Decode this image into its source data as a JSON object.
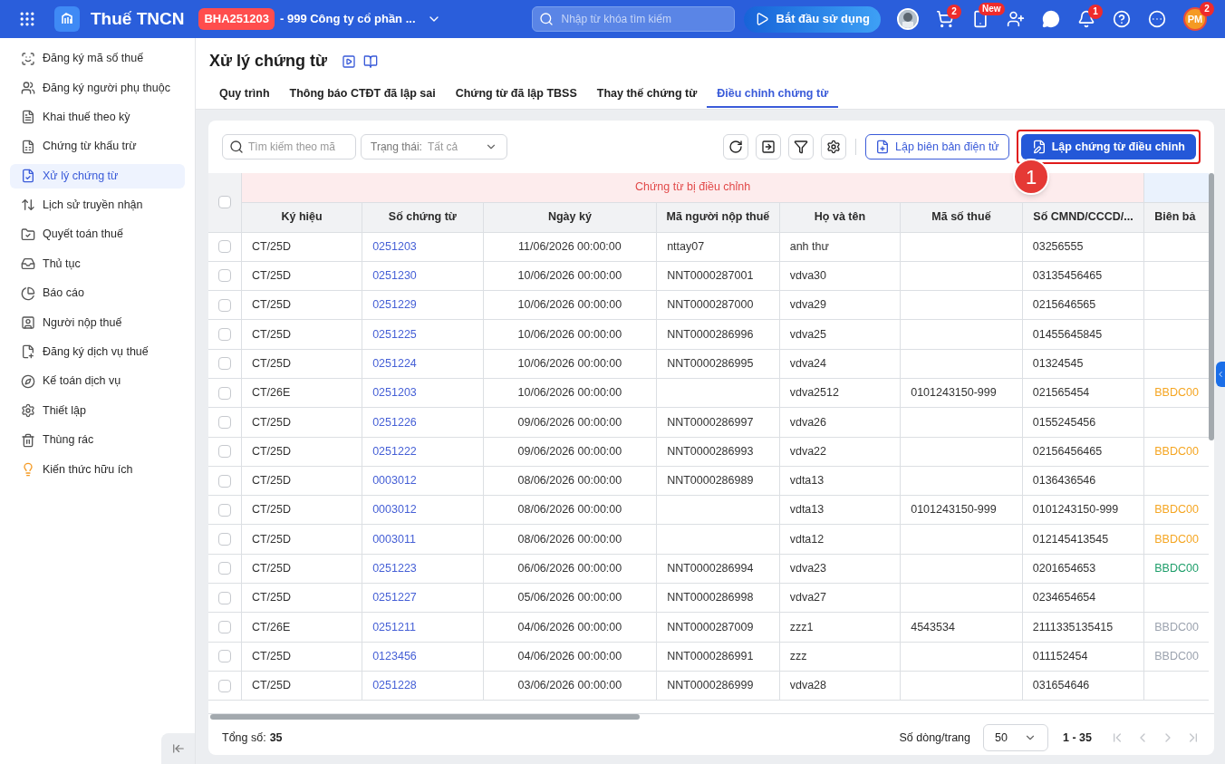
{
  "topbar": {
    "app_name": "Thuế TNCN",
    "tenant_code": "BHA251203",
    "tenant_name": "- 999 Công ty cổ phần ...",
    "search": {
      "placeholder": "Nhập từ khóa tìm kiếm"
    },
    "start_button": "Bắt đầu sử dụng",
    "cart_badge": "2",
    "phone_badge": "New",
    "bell_badge": "1",
    "user_initials": "PM",
    "user_badge": "2"
  },
  "sidebar": {
    "items": [
      {
        "label": "Đăng ký mã số thuế",
        "selected": false
      },
      {
        "label": "Đăng ký người phụ thuộc",
        "selected": false
      },
      {
        "label": "Khai thuế theo kỳ",
        "selected": false
      },
      {
        "label": "Chứng từ khấu trừ",
        "selected": false
      },
      {
        "label": "Xử lý chứng từ",
        "selected": true
      },
      {
        "label": "Lịch sử truyền nhận",
        "selected": false
      },
      {
        "label": "Quyết toán thuế",
        "selected": false
      },
      {
        "label": "Thủ tục",
        "selected": false
      },
      {
        "label": "Báo cáo",
        "selected": false
      },
      {
        "label": "Người nộp thuế",
        "selected": false
      },
      {
        "label": "Đăng ký dịch vụ thuế",
        "selected": false
      },
      {
        "label": "Kế toán dịch vụ",
        "selected": false
      },
      {
        "label": "Thiết lập",
        "selected": false
      },
      {
        "label": "Thùng rác",
        "selected": false
      },
      {
        "label": "Kiến thức hữu ích",
        "selected": false
      }
    ]
  },
  "page": {
    "title": "Xử lý chứng từ",
    "tabs": [
      {
        "label": "Quy trình",
        "selected": false
      },
      {
        "label": "Thông báo CTĐT đã lập sai",
        "selected": false
      },
      {
        "label": "Chứng từ đã lập TBSS",
        "selected": false
      },
      {
        "label": "Thay thế chứng từ",
        "selected": false
      },
      {
        "label": "Điều chỉnh chứng từ",
        "selected": true
      }
    ]
  },
  "toolbar": {
    "search": {
      "placeholder": "Tìm kiếm theo mã"
    },
    "status_filter": {
      "label": "Trạng thái:",
      "value": "Tất cả"
    },
    "secondary_button": "Lập biên bản điện tử",
    "primary_button": "Lập chứng từ điều chỉnh",
    "callout": {
      "number": "1",
      "highlighted": true
    }
  },
  "table": {
    "select_all_checked": false,
    "group_header": "Chứng từ bị điều chỉnh",
    "columns": [
      "Ký hiệu",
      "Số chứng từ",
      "Ngày ký",
      "Mã người nộp thuế",
      "Họ và tên",
      "Mã số thuế",
      "Số CMND/CCCD/...",
      "Biên bả"
    ],
    "rows": [
      {
        "checked": false,
        "cells": [
          "CT/25D",
          "0251203",
          "11/06/2026 00:00:00",
          "nttay07",
          "anh thư",
          "",
          "03256555",
          ""
        ]
      },
      {
        "checked": false,
        "cells": [
          "CT/25D",
          "0251230",
          "10/06/2026 00:00:00",
          "NNT0000287001",
          "vdva30",
          "",
          "03135456465",
          ""
        ]
      },
      {
        "checked": false,
        "cells": [
          "CT/25D",
          "0251229",
          "10/06/2026 00:00:00",
          "NNT0000287000",
          "vdva29",
          "",
          "0215646565",
          ""
        ]
      },
      {
        "checked": false,
        "cells": [
          "CT/25D",
          "0251225",
          "10/06/2026 00:00:00",
          "NNT0000286996",
          "vdva25",
          "",
          "01455645845",
          ""
        ]
      },
      {
        "checked": false,
        "cells": [
          "CT/25D",
          "0251224",
          "10/06/2026 00:00:00",
          "NNT0000286995",
          "vdva24",
          "",
          "01324545",
          ""
        ]
      },
      {
        "checked": false,
        "cells": [
          "CT/26E",
          "0251203",
          "10/06/2026 00:00:00",
          "",
          "vdva2512",
          "0101243150-999",
          "021565454",
          "BBDC00"
        ],
        "color": "#f5a623"
      },
      {
        "checked": false,
        "cells": [
          "CT/25D",
          "0251226",
          "09/06/2026 00:00:00",
          "NNT0000286997",
          "vdva26",
          "",
          "0155245456",
          ""
        ]
      },
      {
        "checked": false,
        "cells": [
          "CT/25D",
          "0251222",
          "09/06/2026 00:00:00",
          "NNT0000286993",
          "vdva22",
          "",
          "02156456465",
          "BBDC00"
        ],
        "color": "#f5a623"
      },
      {
        "checked": false,
        "cells": [
          "CT/25D",
          "0003012",
          "08/06/2026 00:00:00",
          "NNT0000286989",
          "vdta13",
          "",
          "0136436546",
          ""
        ]
      },
      {
        "checked": false,
        "cells": [
          "CT/25D",
          "0003012",
          "08/06/2026 00:00:00",
          "",
          "vdta13",
          "0101243150-999",
          "0101243150-999",
          "BBDC00"
        ],
        "color": "#f5a623"
      },
      {
        "checked": false,
        "cells": [
          "CT/25D",
          "0003011",
          "08/06/2026 00:00:00",
          "",
          "vdta12",
          "",
          "012145413545",
          "BBDC00"
        ],
        "color": "#f5a623"
      },
      {
        "checked": false,
        "cells": [
          "CT/25D",
          "0251223",
          "06/06/2026 00:00:00",
          "NNT0000286994",
          "vdva23",
          "",
          "0201654653",
          "BBDC00"
        ],
        "color": "#1e9e6a"
      },
      {
        "checked": false,
        "cells": [
          "CT/25D",
          "0251227",
          "05/06/2026 00:00:00",
          "NNT0000286998",
          "vdva27",
          "",
          "0234654654",
          ""
        ]
      },
      {
        "checked": false,
        "cells": [
          "CT/26E",
          "0251211",
          "04/06/2026 00:00:00",
          "NNT0000287009",
          "zzz1",
          "4543534",
          "2111335135415",
          "BBDC00"
        ],
        "color": "#9ca3af"
      },
      {
        "checked": false,
        "cells": [
          "CT/25D",
          "0123456",
          "04/06/2026 00:00:00",
          "NNT0000286991",
          "zzz",
          "",
          "011152454",
          "BBDC00"
        ],
        "color": "#9ca3af"
      },
      {
        "checked": false,
        "cells": [
          "CT/25D",
          "0251228",
          "03/06/2026 00:00:00",
          "NNT0000286999",
          "vdva28",
          "",
          "031654646",
          ""
        ]
      }
    ]
  },
  "footer": {
    "total_label": "Tổng số:",
    "total": "35",
    "page_size_label": "Số dòng/trang",
    "page_size": "50",
    "range": "1 - 35"
  }
}
